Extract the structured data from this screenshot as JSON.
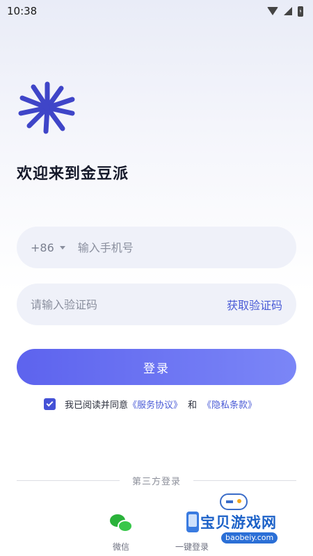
{
  "status_bar": {
    "time": "10:38"
  },
  "login": {
    "welcome_title": "欢迎来到金豆派",
    "country_code": "+86",
    "phone_placeholder": "输入手机号",
    "code_placeholder": "请输入验证码",
    "get_code_label": "获取验证码",
    "login_button_label": "登录",
    "agreement": {
      "checked": true,
      "prefix": "我已阅读并同意",
      "terms_link": "《服务协议》",
      "conjunction": "和",
      "privacy_link": "《隐私条款》"
    }
  },
  "third_party": {
    "title": "第三方登录",
    "options": [
      {
        "label": "微信",
        "icon": "wechat-icon"
      },
      {
        "label": "一键登录",
        "icon": "phone-icon"
      }
    ]
  },
  "watermark": {
    "title": "宝贝游戏网",
    "url": "baobeiy.com"
  },
  "colors": {
    "accent": "#4a5bd6",
    "button_start": "#5d63ee",
    "button_end": "#7b86f7",
    "wechat": "#2ab23a"
  }
}
